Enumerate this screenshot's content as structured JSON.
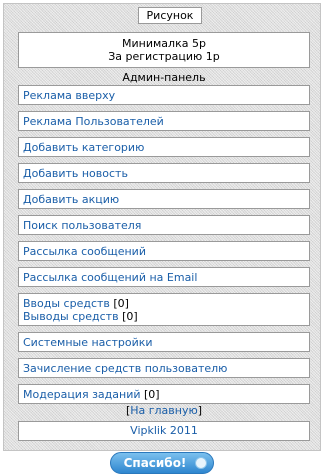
{
  "header": {
    "title": "Рисунок"
  },
  "prices": {
    "line1": "Минималка 5р",
    "line2": "За регистрацию 1р"
  },
  "admin": {
    "title": "Админ-панель",
    "items": [
      {
        "label": "Реклама вверху"
      },
      {
        "label": "Реклама Пользователей"
      },
      {
        "label": "Добавить категорию"
      },
      {
        "label": "Добавить новость"
      },
      {
        "label": "Добавить акцию"
      },
      {
        "label": "Поиск пользователя"
      },
      {
        "label": "Рассылка сообщений"
      },
      {
        "label": "Рассылка сообщений на Email"
      }
    ],
    "funds": {
      "deposits_label": "Вводы средств",
      "deposits_count": "[0]",
      "withdrawals_label": "Выводы средств",
      "withdrawals_count": "[0]"
    },
    "settings_label": "Системные настройки",
    "credit_label": "Зачисление средств пользователю",
    "moderation_label": "Модерация заданий",
    "moderation_count": "[0]"
  },
  "back": {
    "bracket_open": "[",
    "label": "На главную",
    "bracket_close": "]"
  },
  "footer": {
    "text": "Vipklik 2011"
  },
  "thanks_button": {
    "label": "Спасибо!"
  },
  "colors": {
    "link": "#1a5ea8",
    "button": "#2e86cf"
  }
}
